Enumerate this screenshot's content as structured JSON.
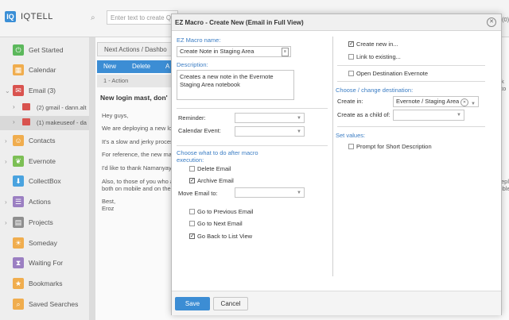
{
  "app": {
    "logo_letter": "IQ",
    "name": "IQTELL",
    "search_placeholder": "Enter text to create Q"
  },
  "sidebar": {
    "items": [
      {
        "label": "Get Started",
        "icon": "power-icon",
        "color": "#5cb85c",
        "glyph": "⏻"
      },
      {
        "label": "Calendar",
        "icon": "calendar-icon",
        "color": "#f0ad4e",
        "glyph": "▦"
      },
      {
        "label": "Email (3)",
        "icon": "email-icon",
        "color": "#d9534f",
        "glyph": "✉"
      },
      {
        "label": "Contacts",
        "icon": "contacts-icon",
        "color": "#f0ad4e",
        "glyph": "☺"
      },
      {
        "label": "Evernote",
        "icon": "evernote-icon",
        "color": "#7cbf55",
        "glyph": "❦"
      },
      {
        "label": "CollectBox",
        "icon": "collectbox-icon",
        "color": "#4aa3df",
        "glyph": "⬇"
      },
      {
        "label": "Actions",
        "icon": "actions-icon",
        "color": "#9b7fc2",
        "glyph": "☰"
      },
      {
        "label": "Projects",
        "icon": "projects-icon",
        "color": "#8e8e8e",
        "glyph": "▤"
      },
      {
        "label": "Someday",
        "icon": "someday-icon",
        "color": "#f0ad4e",
        "glyph": "☀"
      },
      {
        "label": "Waiting For",
        "icon": "waiting-icon",
        "color": "#9b7fc2",
        "glyph": "⧗"
      },
      {
        "label": "Bookmarks",
        "icon": "bookmarks-icon",
        "color": "#f0ad4e",
        "glyph": "★"
      },
      {
        "label": "Saved Searches",
        "icon": "saved-searches-icon",
        "color": "#f0ad4e",
        "glyph": "⌕"
      }
    ],
    "email_accounts": [
      {
        "label": "(2) gmail - dann.alt"
      },
      {
        "label": "(1) makeuseof - da"
      }
    ]
  },
  "main": {
    "tab_label": "Next Actions / Dashbo",
    "buttons": {
      "new": "New",
      "delete": "Delete",
      "more": "A"
    },
    "row_header": "1 - Action",
    "email_subject": "New login mast, don'",
    "email_lines": [
      "Hey guys,",
      "We are deploying a new lo",
      "It's a slow and jerky proces",
      "For reference, the new ma",
      "I'd like to thank Namanyay",
      "Also, to those of you who a",
      "both on mobile and on the",
      "Best,",
      "Eroz"
    ],
    "right_fragments": {
      "zero": "(0)",
      "k_to": "k to",
      "epl": "epl",
      "ible": "ible"
    }
  },
  "modal": {
    "title": "EZ Macro - Create New (Email in Full View)",
    "macro_name_label": "EZ Macro name:",
    "macro_name_value": "Create Note in Staging Area",
    "description_label": "Description:",
    "description_value": "Creates a new note in the Evernote Staging Area notebook",
    "reminder_label": "Reminder:",
    "calendar_event_label": "Calendar Event:",
    "choose_after_label": "Choose what to do after macro execution:",
    "delete_email": "Delete Email",
    "archive_email": "Archive Email",
    "move_email_label": "Move Email to:",
    "go_prev": "Go to Previous Email",
    "go_next": "Go to Next Email",
    "go_back": "Go Back to List View",
    "create_new": "Create new in...",
    "link_existing": "Link to existing...",
    "open_dest": "Open Destination Evernote",
    "choose_dest_label": "Choose / change destination:",
    "create_in_label": "Create in:",
    "create_in_value": "Evernote / Staging Area",
    "create_child_label": "Create as a child of:",
    "set_values_label": "Set values:",
    "prompt_short": "Prompt for Short Description",
    "checks": {
      "delete_email": false,
      "archive_email": true,
      "go_prev": false,
      "go_next": false,
      "go_back": true,
      "create_new": true,
      "link_existing": false,
      "open_dest": false,
      "prompt_short": false
    },
    "save_label": "Save",
    "cancel_label": "Cancel"
  },
  "colors": {
    "accent": "#3c8dd4",
    "label_blue": "#3b7dc4"
  }
}
